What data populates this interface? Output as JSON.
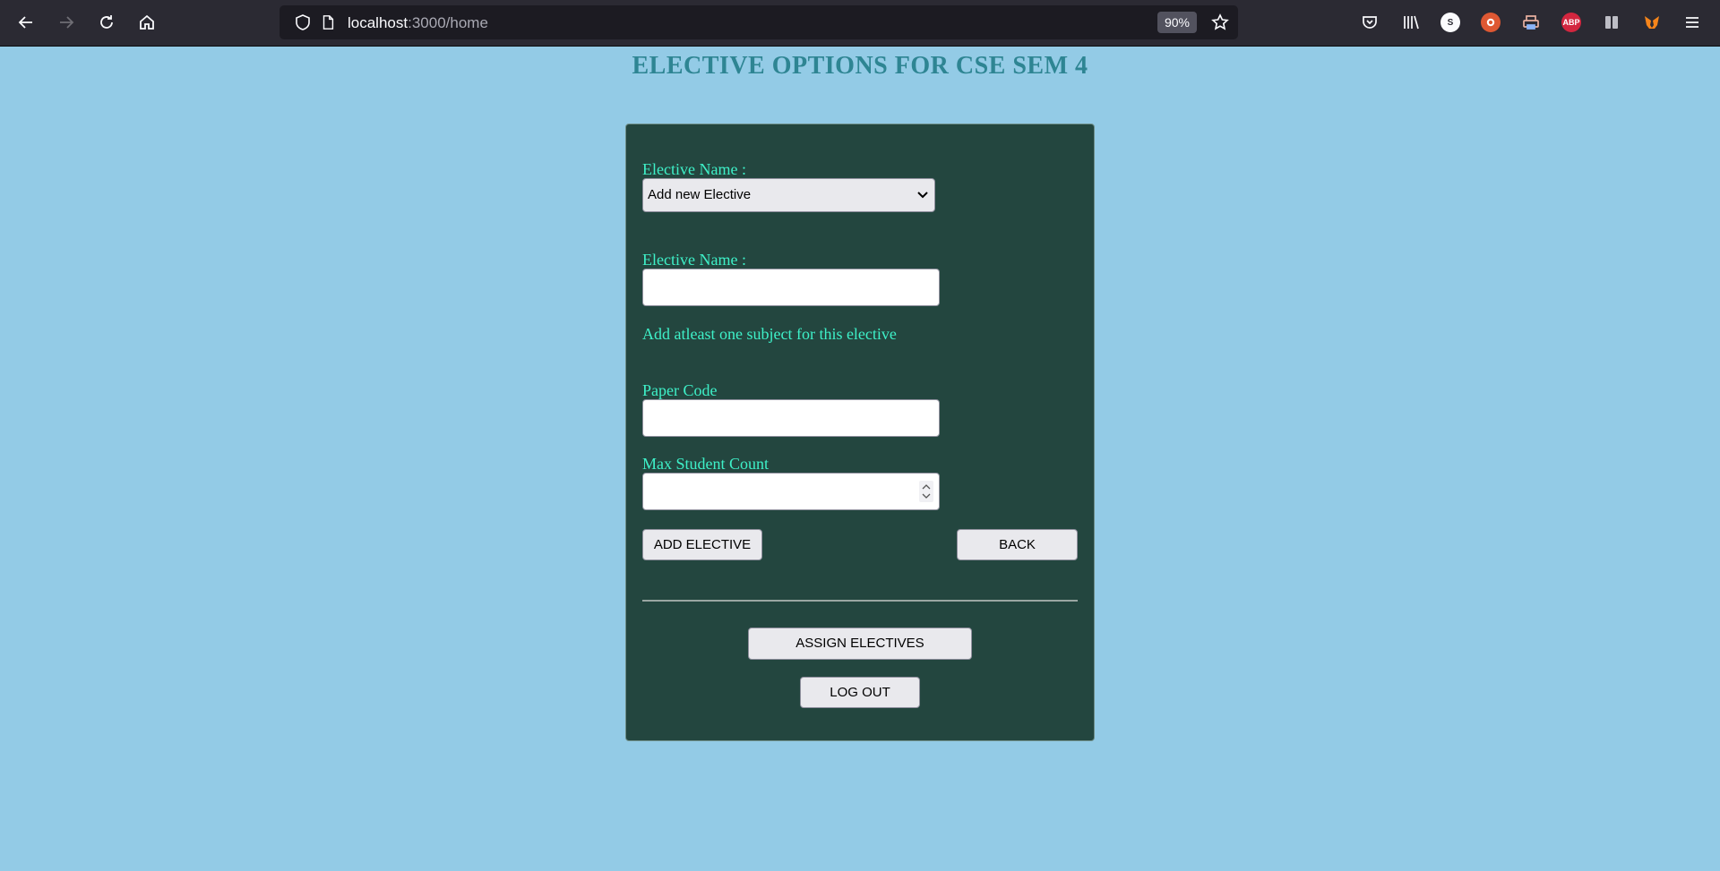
{
  "browser": {
    "url_host": "localhost",
    "url_path": ":3000/home",
    "zoom": "90%",
    "extensions": [
      "pocket-icon",
      "library-icon",
      "s-extension-icon",
      "duckduckgo-icon",
      "printer-icon",
      "adblock-plus-icon",
      "reader-icon",
      "metamask-icon",
      "menu-icon"
    ],
    "ext_s_label": "S",
    "ext_abp_label": "ABP"
  },
  "page": {
    "title": "ELECTIVE OPTIONS FOR CSE SEM 4"
  },
  "form": {
    "select_label": "Elective Name :",
    "select_value": "Add new Elective",
    "name_label": "Elective Name :",
    "name_value": "",
    "hint": "Add atleast one subject for this elective",
    "paper_code_label": "Paper Code",
    "paper_code_value": "",
    "max_count_label": "Max Student Count",
    "max_count_value": "",
    "add_button": "ADD ELECTIVE",
    "back_button": "BACK",
    "assign_button": "ASSIGN ELECTIVES",
    "logout_button": "LOG OUT"
  },
  "colors": {
    "page_bg": "#93cbe6",
    "card_bg": "#23463f",
    "label": "#3ef0c8",
    "title": "#2e8593"
  }
}
